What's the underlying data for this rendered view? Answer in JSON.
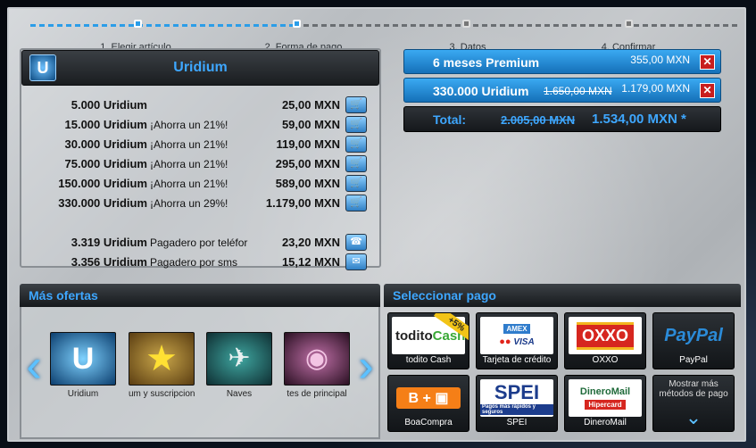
{
  "steps": [
    {
      "label": "1. Elegir artículo"
    },
    {
      "label": "2. Forma de pago"
    },
    {
      "label": "3. Datos"
    },
    {
      "label": "4. Confirmar"
    }
  ],
  "uridium_panel": {
    "title": "Uridium",
    "logo": "U",
    "offers": [
      {
        "amount": "5.000 Uridium",
        "note": "",
        "price": "25,00 MXN"
      },
      {
        "amount": "15.000 Uridium",
        "note": "¡Ahorra un 21%!",
        "price": "59,00 MXN"
      },
      {
        "amount": "30.000 Uridium",
        "note": "¡Ahorra un 21%!",
        "price": "119,00 MXN"
      },
      {
        "amount": "75.000 Uridium",
        "note": "¡Ahorra un 21%!",
        "price": "295,00 MXN"
      },
      {
        "amount": "150.000 Uridium",
        "note": "¡Ahorra un 21%!",
        "price": "589,00 MXN"
      },
      {
        "amount": "330.000 Uridium",
        "note": "¡Ahorra un 29%!",
        "price": "1.179,00 MXN"
      },
      {
        "amount": "3.319 Uridium",
        "note": "Pagadero por teléfor",
        "price": "23,20 MXN"
      },
      {
        "amount": "3.356 Uridium",
        "note": "Pagadero por sms",
        "price": "15,12 MXN"
      }
    ]
  },
  "cart": {
    "items": [
      {
        "name": "6 meses Premium",
        "old_price": "",
        "price": "355,00 MXN"
      },
      {
        "name": "330.000 Uridium",
        "old_price": "1.650,00 MXN",
        "price": "1.179,00 MXN"
      }
    ],
    "total_label": "Total:",
    "total_old": "2.005,00 MXN",
    "total_new": "1.534,00 MXN *"
  },
  "more_offers": {
    "title": "Más ofertas",
    "tiles": [
      {
        "label": "Uridium"
      },
      {
        "label": "um y suscripcion"
      },
      {
        "label": "Naves"
      },
      {
        "label": "tes de principal"
      }
    ]
  },
  "payment": {
    "title": "Seleccionar pago",
    "methods": [
      {
        "name": "todito Cash",
        "logo": "todito Cash",
        "badge": "+5%"
      },
      {
        "name": "Tarjeta de crédito",
        "logo": "VISA"
      },
      {
        "name": "OXXO",
        "logo": "OXXO"
      },
      {
        "name": "PayPal",
        "logo": "PayPal"
      },
      {
        "name": "BoaCompra",
        "logo": "B + ▣"
      },
      {
        "name": "SPEI",
        "logo": "SPEI"
      },
      {
        "name": "DineroMail",
        "logo": "DineroMail"
      },
      {
        "name": "Mostrar más métodos de pago",
        "logo": ""
      }
    ],
    "spei_sub": "Pagos más rápidos y seguros",
    "dinero_sub": "Hipercard"
  },
  "colors": {
    "accent": "#3ea7ff",
    "cart_blue": "#1f87d4",
    "delete_red": "#c81e1e"
  }
}
